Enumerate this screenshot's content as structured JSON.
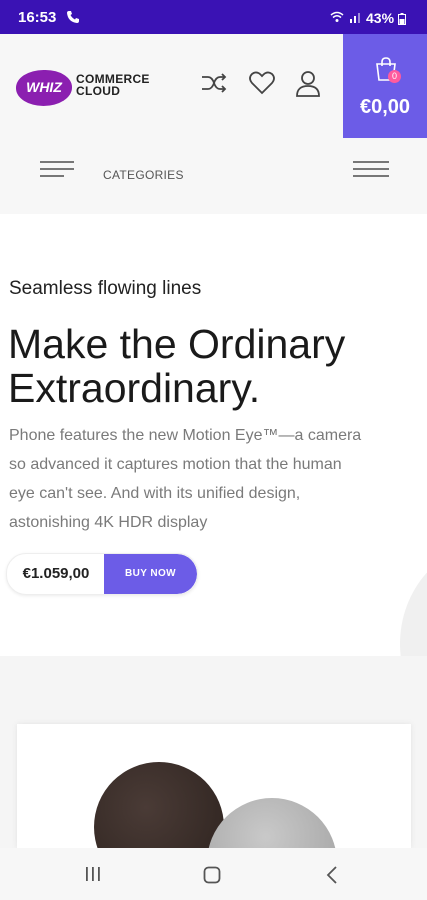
{
  "status_bar": {
    "time": "16:53",
    "battery": "43%"
  },
  "header": {
    "logo_badge": "WHIZ",
    "logo_line1": "COMMERCE",
    "logo_line2": "CLOUD",
    "cart_count": "0",
    "cart_total": "€0,00",
    "accent_color": "#6c5ce7"
  },
  "category_bar": {
    "label": "CATEGORIES"
  },
  "hero": {
    "subtitle": "Seamless flowing lines",
    "title": "Make the Ordinary Extraordinary.",
    "description": "Phone features the new Motion Eye™—a camera so advanced it captures motion that the human eye can't see. And with its unified design, astonishing 4K HDR display",
    "price": "€1.059,00",
    "buy_label": "BUY NOW"
  },
  "icons": {
    "compare": "shuffle-icon",
    "wishlist": "heart-icon",
    "account": "user-icon",
    "cart": "shopping-bag-icon",
    "nav_recent": "recent-apps-icon",
    "nav_home": "home-icon",
    "nav_back": "back-icon"
  }
}
